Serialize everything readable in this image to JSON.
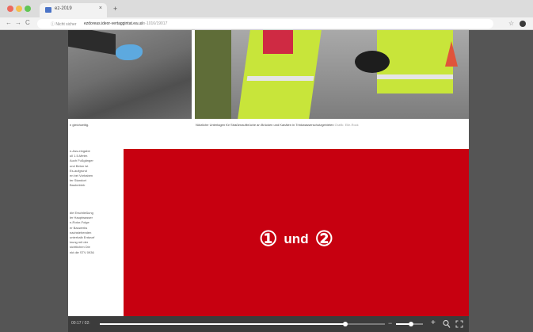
{
  "browser": {
    "tab_title": "ez-2019",
    "tab_close": "×",
    "new_tab": "+",
    "nav_back": "←",
    "nav_forward": "→",
    "nav_reload": "C",
    "url_prefix": "ⓘ Nicht sicher",
    "url_host": "ezdoreas.ideor-vertaggintat.ea.us",
    "url_rest": "/ln-1016/19017",
    "star": "☆"
  },
  "article": {
    "caption_left": "n gleichzeitig.",
    "caption_right": "Nützliche Unterlagen für Straßenaufbrüche an Brücken und Kanälen in Trinkwasserschutzgebieten",
    "caption_credit": "Grafik: Elle-Rock",
    "column_a_lines": [
      "n-Ass-eingabe",
      "ull 1.5-Meter.",
      "Auch Fußgänger",
      "und Beton ist",
      "Es-aufgrund",
      "en bei Vorhaben",
      "ter Standort",
      "Baubetrieb"
    ],
    "column_b_lines": [
      "die Erschließung",
      "ler Hauptwasser",
      "n-Rotor-Folge",
      "er Bauwerks",
      "nachstehenden",
      "unterhalb Entwurf",
      "tzung mit der",
      "sichtlichen Die",
      "nkt die STV 0936"
    ]
  },
  "overlay": {
    "label_left": "①",
    "label_mid": "und",
    "label_right": "②",
    "color": "#c70010"
  },
  "player": {
    "time": "00:17 / 02:",
    "progress": 0.86,
    "zoom_minus": "−",
    "zoom_plus": "+",
    "zoom_level": 0.55
  }
}
